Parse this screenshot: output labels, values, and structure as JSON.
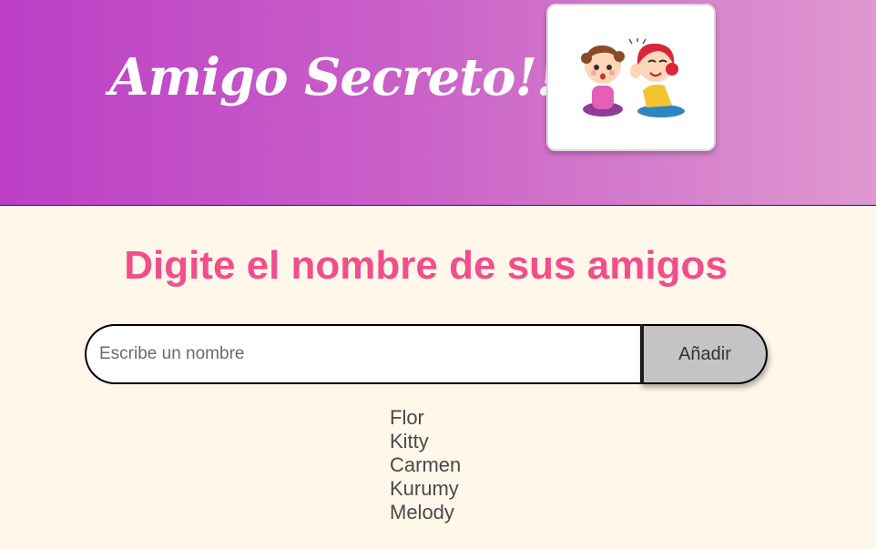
{
  "header": {
    "title": "Amigo Secreto!!",
    "background_colors": [
      "#BC3FC6",
      "#DF98D0"
    ],
    "logo_icon": "two-kids-whispering-illustration"
  },
  "main": {
    "heading": "Digite el nombre de sus amigos",
    "heading_color": "#F04E8C",
    "input": {
      "placeholder": "Escribe un nombre",
      "value": ""
    },
    "add_button_label": "Añadir",
    "friends": [
      "Flor",
      "Kitty",
      "Carmen",
      "Kurumy",
      "Melody"
    ]
  }
}
